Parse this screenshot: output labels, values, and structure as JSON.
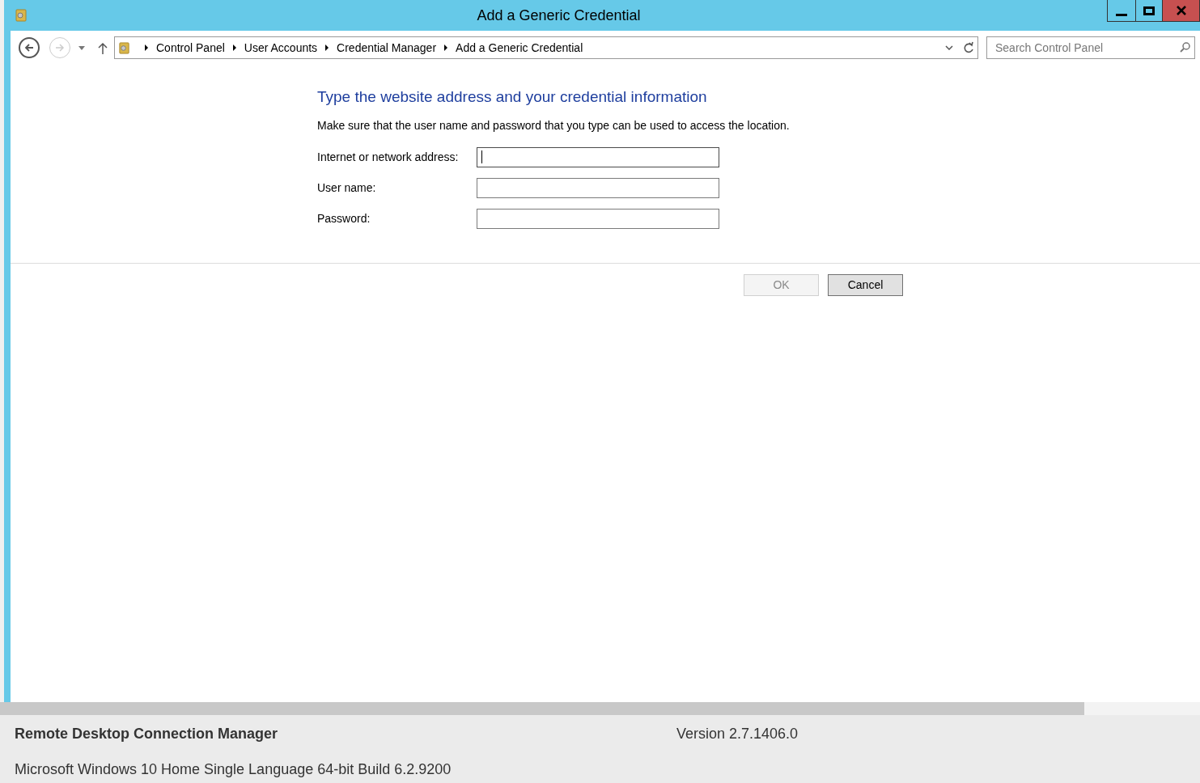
{
  "window": {
    "title": "Add a Generic Credential"
  },
  "breadcrumb": [
    "Control Panel",
    "User Accounts",
    "Credential Manager",
    "Add a Generic Credential"
  ],
  "search": {
    "placeholder": "Search Control Panel"
  },
  "heading": "Type the website address and your credential information",
  "description": "Make sure that the user name and password that you type can be used to access the location.",
  "fields": [
    {
      "label": "Internet or network address:",
      "focused": true
    },
    {
      "label": "User name:",
      "focused": false
    },
    {
      "label": "Password:",
      "focused": false
    }
  ],
  "buttons": [
    {
      "label": "OK",
      "disabled": true
    },
    {
      "label": "Cancel",
      "disabled": false
    }
  ],
  "footer": {
    "app_name": "Remote Desktop Connection Manager",
    "version": "Version 2.7.1406.0",
    "system": "Microsoft Windows 10 Home Single Language 64-bit Build 6.2.9200"
  }
}
